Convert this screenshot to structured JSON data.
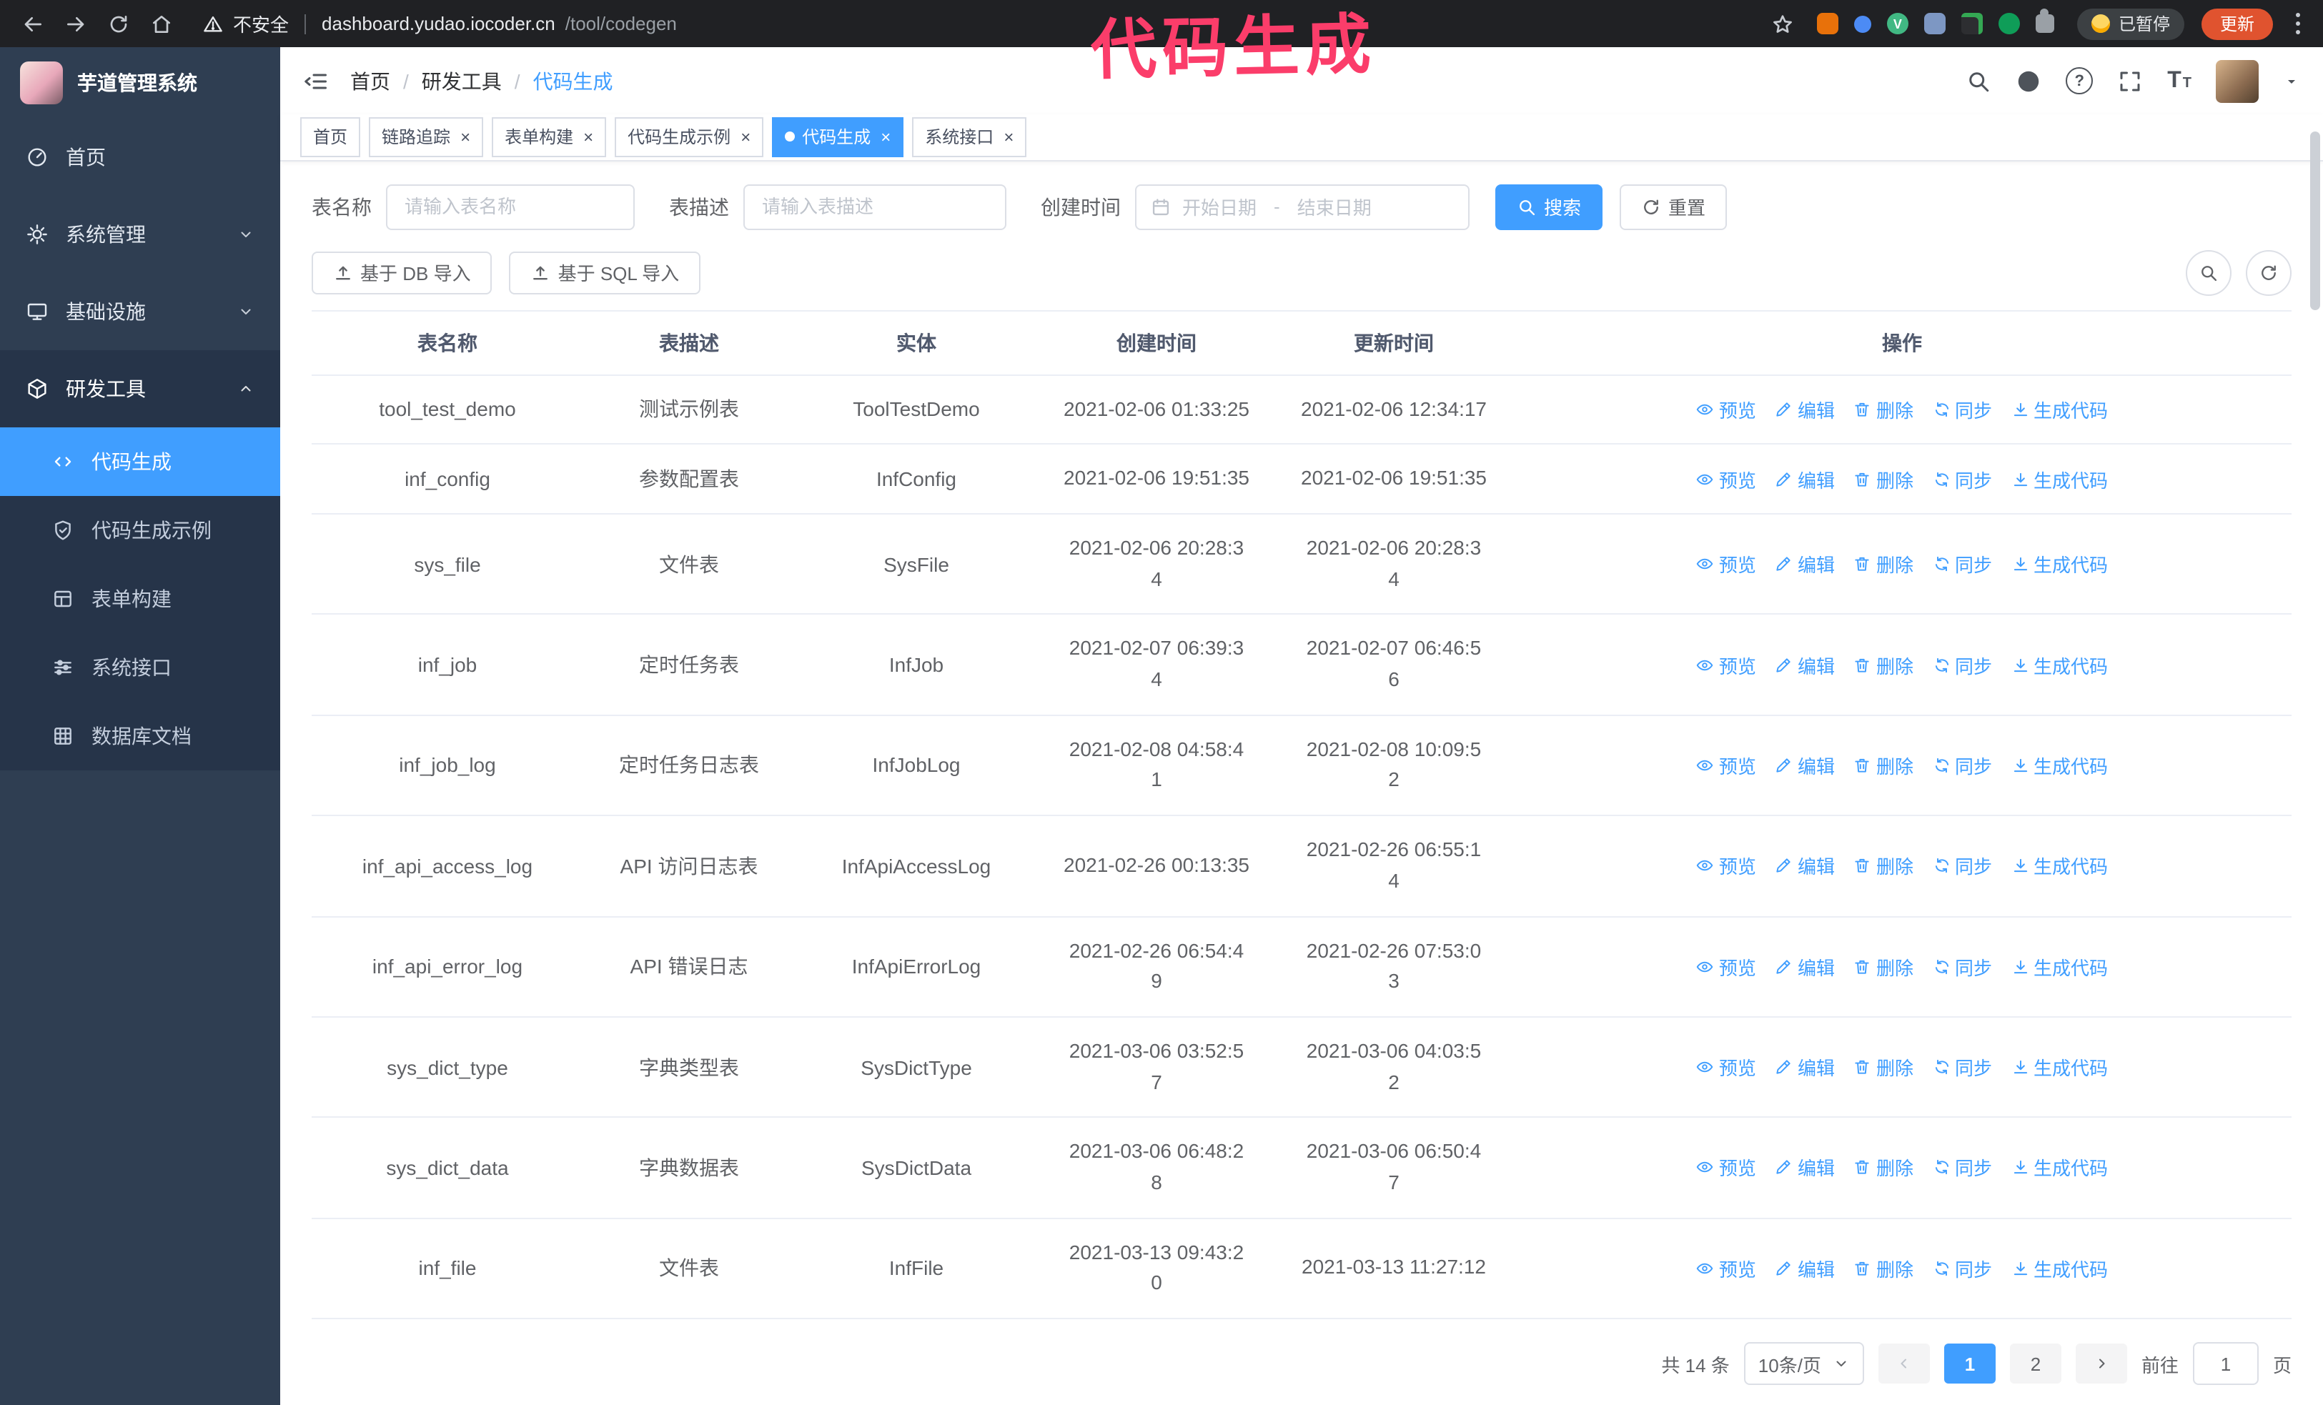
{
  "annotation": {
    "text": "代码生成",
    "color": "#fb3d6a"
  },
  "browser": {
    "security_label": "不安全",
    "url_host": "dashboard.yudao.iocoder.cn",
    "url_path": "/tool/codegen",
    "paused_badge": "已暂停",
    "update_button": "更新"
  },
  "sidebar": {
    "app_title": "芋道管理系统",
    "items": [
      {
        "key": "home",
        "label": "首页",
        "icon": "gauge"
      },
      {
        "key": "system",
        "label": "系统管理",
        "icon": "gear",
        "expandable": true
      },
      {
        "key": "infra",
        "label": "基础设施",
        "icon": "monitor",
        "expandable": true
      },
      {
        "key": "dev-tools",
        "label": "研发工具",
        "icon": "cube",
        "expandable": true,
        "expanded": true,
        "active": true,
        "children": [
          {
            "key": "codegen",
            "label": "代码生成",
            "icon": "code",
            "active": true
          },
          {
            "key": "codegen-example",
            "label": "代码生成示例",
            "icon": "shield"
          },
          {
            "key": "form-builder",
            "label": "表单构建",
            "icon": "form"
          },
          {
            "key": "system-api",
            "label": "系统接口",
            "icon": "sliders"
          },
          {
            "key": "db-doc",
            "label": "数据库文档",
            "icon": "grid"
          }
        ]
      }
    ]
  },
  "header": {
    "breadcrumb": [
      "首页",
      "研发工具",
      "代码生成"
    ],
    "right_icons": [
      "search",
      "github",
      "help",
      "fullscreen",
      "font-size",
      "avatar"
    ]
  },
  "tabs": [
    {
      "key": "home",
      "label": "首页",
      "closable": false
    },
    {
      "key": "tracing",
      "label": "链路追踪",
      "closable": true
    },
    {
      "key": "form-builder",
      "label": "表单构建",
      "closable": true
    },
    {
      "key": "codegen-example",
      "label": "代码生成示例",
      "closable": true
    },
    {
      "key": "codegen",
      "label": "代码生成",
      "closable": true,
      "active": true
    },
    {
      "key": "system-api",
      "label": "系统接口",
      "closable": true
    }
  ],
  "filters": {
    "table_name_label": "表名称",
    "table_name_placeholder": "请输入表名称",
    "table_desc_label": "表描述",
    "table_desc_placeholder": "请输入表描述",
    "create_time_label": "创建时间",
    "date_start_placeholder": "开始日期",
    "date_separator": "-",
    "date_end_placeholder": "结束日期",
    "search_label": "搜索",
    "reset_label": "重置"
  },
  "toolbar": {
    "import_db_label": "基于 DB 导入",
    "import_sql_label": "基于 SQL 导入"
  },
  "table": {
    "columns": [
      "表名称",
      "表描述",
      "实体",
      "创建时间",
      "更新时间",
      "操作"
    ],
    "operations": [
      {
        "key": "preview",
        "label": "预览",
        "icon": "eye"
      },
      {
        "key": "edit",
        "label": "编辑",
        "icon": "edit"
      },
      {
        "key": "delete",
        "label": "删除",
        "icon": "trash"
      },
      {
        "key": "sync",
        "label": "同步",
        "icon": "sync"
      },
      {
        "key": "generate-code",
        "label": "生成代码",
        "icon": "download"
      }
    ],
    "rows": [
      {
        "name": "tool_test_demo",
        "desc": "测试示例表",
        "entity": "ToolTestDemo",
        "created": "2021-02-06 01:33:25",
        "updated": "2021-02-06 12:34:17"
      },
      {
        "name": "inf_config",
        "desc": "参数配置表",
        "entity": "InfConfig",
        "created": "2021-02-06 19:51:35",
        "updated": "2021-02-06 19:51:35"
      },
      {
        "name": "sys_file",
        "desc": "文件表",
        "entity": "SysFile",
        "created": "2021-02-06 20:28:3\n4",
        "updated": "2021-02-06 20:28:3\n4"
      },
      {
        "name": "inf_job",
        "desc": "定时任务表",
        "entity": "InfJob",
        "created": "2021-02-07 06:39:3\n4",
        "updated": "2021-02-07 06:46:5\n6"
      },
      {
        "name": "inf_job_log",
        "desc": "定时任务日志表",
        "entity": "InfJobLog",
        "created": "2021-02-08 04:58:4\n1",
        "updated": "2021-02-08 10:09:5\n2"
      },
      {
        "name": "inf_api_access_log",
        "desc": "API 访问日志表",
        "entity": "InfApiAccessLog",
        "created": "2021-02-26 00:13:35",
        "updated": "2021-02-26 06:55:1\n4"
      },
      {
        "name": "inf_api_error_log",
        "desc": "API 错误日志",
        "entity": "InfApiErrorLog",
        "created": "2021-02-26 06:54:4\n9",
        "updated": "2021-02-26 07:53:0\n3"
      },
      {
        "name": "sys_dict_type",
        "desc": "字典类型表",
        "entity": "SysDictType",
        "created": "2021-03-06 03:52:5\n7",
        "updated": "2021-03-06 04:03:5\n2"
      },
      {
        "name": "sys_dict_data",
        "desc": "字典数据表",
        "entity": "SysDictData",
        "created": "2021-03-06 06:48:2\n8",
        "updated": "2021-03-06 06:50:4\n7"
      },
      {
        "name": "inf_file",
        "desc": "文件表",
        "entity": "InfFile",
        "created": "2021-03-13 09:43:2\n0",
        "updated": "2021-03-13 11:27:12"
      }
    ]
  },
  "pagination": {
    "total_text": "共 14 条",
    "page_size": "10条/页",
    "pages": [
      "1",
      "2"
    ],
    "active_page": "1",
    "goto_label": "前往",
    "goto_value": "1",
    "goto_suffix": "页"
  }
}
